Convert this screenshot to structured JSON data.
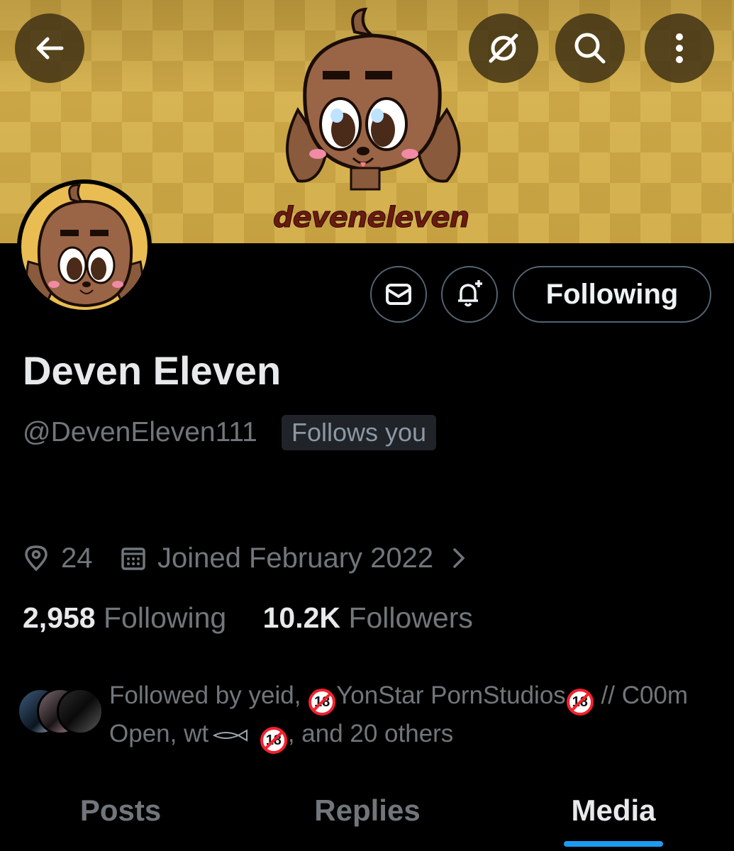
{
  "banner": {
    "logo_text": "deveneleven"
  },
  "header": {
    "back_label": "",
    "icons": [
      "back-arrow-icon",
      "grok-icon",
      "search-icon",
      "more-vertical-icon"
    ]
  },
  "actions": {
    "following_label": "Following"
  },
  "profile": {
    "display_name": "Deven Eleven",
    "handle": "@DevenEleven111",
    "follows_you": "Follows you",
    "location": "24",
    "joined": "Joined February 2022"
  },
  "stats": {
    "following_count": "2,958",
    "following_label": "Following",
    "followers_count": "10.2K",
    "followers_label": "Followers"
  },
  "followed_by": {
    "prefix": "Followed by yeid, ",
    "name2": "YonStar PornStudios",
    "sep": " //",
    "name2_cont": "C00m Open, wt",
    "suffix": ", and 20 others"
  },
  "tabs": [
    {
      "label": "Posts"
    },
    {
      "label": "Replies"
    },
    {
      "label": "Media"
    }
  ],
  "colors": {
    "accent": "#1d9bf0",
    "banner": "#d4b04e",
    "muted": "#71767b"
  }
}
